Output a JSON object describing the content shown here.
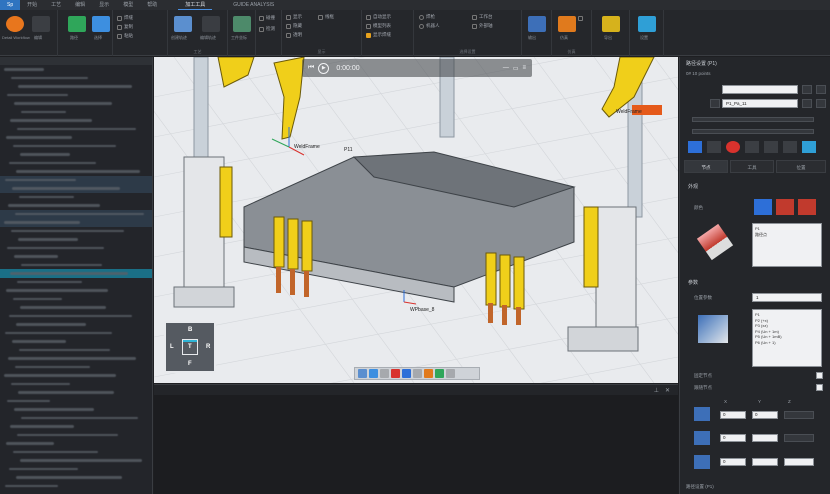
{
  "menu": {
    "items": [
      "Sp",
      "开始",
      "工艺",
      "编辑",
      "显示",
      "模型",
      "帮助",
      "",
      "加工工具",
      "",
      "GUIDE ANALYSIS"
    ],
    "active_index": 0,
    "selected_index": 8
  },
  "ribbon": {
    "groups": [
      {
        "title": "",
        "buttons": [
          "Detail Workflow",
          "编辑"
        ]
      },
      {
        "title": "",
        "buttons": [
          "路径",
          "选择"
        ]
      },
      {
        "title": "",
        "buttons": [
          "焊缝",
          "复制",
          "粘贴"
        ]
      },
      {
        "title": "工艺",
        "buttons": [
          "创建轨迹",
          "编辑轨迹"
        ]
      },
      {
        "title": "",
        "buttons": [
          "工件坐标"
        ]
      },
      {
        "title": "",
        "buttons": [
          "碰撞",
          "检测"
        ]
      },
      {
        "title": "显示",
        "buttons": [
          "显示",
          "隐藏",
          "透明",
          "线框"
        ]
      },
      {
        "title": "",
        "buttons": [
          "自动显示",
          "模型列表",
          "显示焊缝"
        ]
      },
      {
        "title": "选择设置",
        "buttons": [
          "焊枪",
          "机器人",
          "工作台",
          "外部轴"
        ]
      },
      {
        "title": "",
        "buttons": [
          "输出",
          "后置"
        ]
      },
      {
        "title": "仿真",
        "buttons": [
          "仿真",
          "停止"
        ]
      },
      {
        "title": "",
        "buttons": [
          "导出"
        ]
      },
      {
        "title": "",
        "buttons": [
          "设置"
        ]
      }
    ]
  },
  "viewport": {
    "labels": {
      "frame_a": "WeldFrame",
      "frame_a_id": "P11",
      "frame_b": "WeldFrame",
      "frame_c": "WPbase_8"
    },
    "media": {
      "time": "0:00:00"
    },
    "viewcube": {
      "top": "B",
      "left": "L",
      "center": "T",
      "right": "R",
      "bottom": "F"
    }
  },
  "properties": {
    "title": "路径设置 (P1)",
    "row1": "0# 10 points",
    "select_value": "P1_Pa_11",
    "tabs": [
      "节点",
      "工具",
      "位置"
    ],
    "section1": "外观",
    "section1_label": "颜色",
    "list1": [
      "P1",
      "路径点"
    ],
    "section2": "参数",
    "param_label": "位置参数",
    "param_value": "1",
    "list2": [
      "P1",
      "P2 (+x)",
      "P3 (xz)",
      "P4 (Un + 1m)",
      "P5 (Un + 1mB)",
      "P6 (Un + 1)"
    ],
    "check1": "固定节点",
    "check2": "跟随节点",
    "axis_labels": [
      "X",
      "Y",
      "Z"
    ],
    "values": [
      [
        "0",
        "0",
        ""
      ],
      [
        "0",
        "",
        ""
      ],
      [
        "0",
        "",
        ""
      ]
    ],
    "footer": "路径设置 (P1)"
  },
  "colors": {
    "accent": "#2f74c0",
    "robot_yellow": "#f3d21a",
    "teal_highlight": "#1a6f86"
  }
}
